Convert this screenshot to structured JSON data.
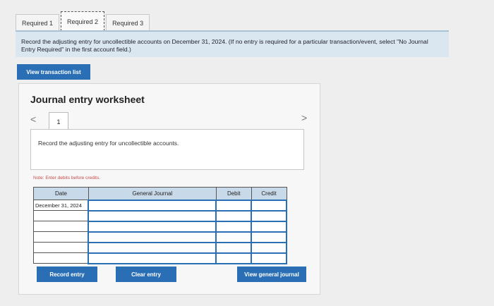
{
  "tabs": [
    {
      "label": "Required 1",
      "active": false
    },
    {
      "label": "Required 2",
      "active": true
    },
    {
      "label": "Required 3",
      "active": false
    }
  ],
  "instruction": "Record the adjusting entry for uncollectible accounts on December 31, 2024. (If no entry is required for a particular transaction/event, select \"No Journal Entry Required\" in the first account field.)",
  "view_transaction_label": "View transaction list",
  "worksheet": {
    "title": "Journal entry worksheet",
    "nav_prev": "<",
    "nav_next": ">",
    "page_number": "1",
    "description": "Record the adjusting entry for uncollectible accounts.",
    "note": "Note: Enter debits before credits."
  },
  "table": {
    "headers": {
      "date": "Date",
      "journal": "General Journal",
      "debit": "Debit",
      "credit": "Credit"
    },
    "rows": [
      {
        "date": "December 31, 2024",
        "account": "",
        "debit": "",
        "credit": ""
      },
      {
        "date": "",
        "account": "",
        "debit": "",
        "credit": ""
      },
      {
        "date": "",
        "account": "",
        "debit": "",
        "credit": ""
      },
      {
        "date": "",
        "account": "",
        "debit": "",
        "credit": ""
      },
      {
        "date": "",
        "account": "",
        "debit": "",
        "credit": ""
      },
      {
        "date": "",
        "account": "",
        "debit": "",
        "credit": ""
      }
    ]
  },
  "buttons": {
    "record": "Record entry",
    "clear": "Clear entry",
    "view_general": "View general journal"
  },
  "colors": {
    "accent": "#2a6fb5",
    "header_bg": "#c8d9ea",
    "instruction_bg": "#dbe7f0",
    "note": "#c84b4b"
  }
}
